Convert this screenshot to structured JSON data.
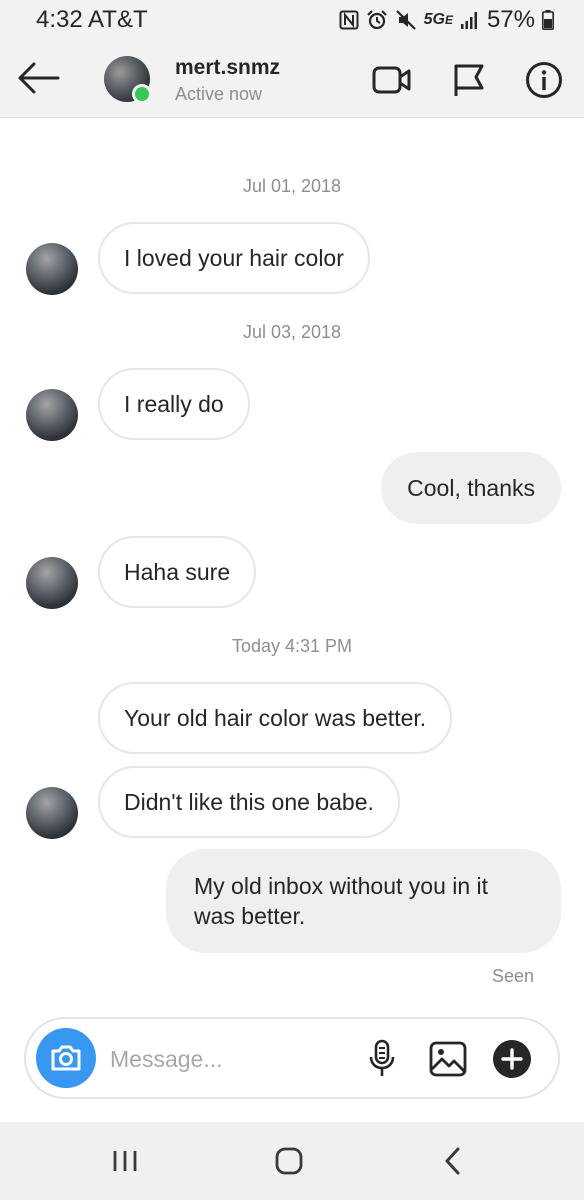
{
  "status_bar": {
    "time": "4:32 AT&T",
    "network": "5G",
    "network_suffix": "E",
    "battery": "57%"
  },
  "header": {
    "contact_name": "mert.snmz",
    "contact_status": "Active now",
    "online_color": "#34c759"
  },
  "conversation": {
    "dates": [
      "Jul 01, 2018",
      "Jul 03, 2018",
      "Today 4:31 PM"
    ],
    "messages": [
      {
        "from": "them",
        "text": "I loved your hair color"
      },
      {
        "from": "them",
        "text": "I really do"
      },
      {
        "from": "me",
        "text": "Cool, thanks"
      },
      {
        "from": "them",
        "text": "Haha sure"
      },
      {
        "from": "them",
        "text": "Your old hair color was better."
      },
      {
        "from": "them",
        "text": "Didn't like this one babe."
      },
      {
        "from": "me",
        "text": "My old inbox without you in it was better."
      }
    ],
    "seen": "Seen"
  },
  "composer": {
    "placeholder": "Message...",
    "accent": "#3897f0"
  },
  "icons": {
    "header": [
      "back-arrow-icon",
      "video-camera-icon",
      "flag-icon",
      "info-icon"
    ],
    "composer": [
      "camera-icon",
      "microphone-icon",
      "gallery-icon",
      "plus-icon"
    ],
    "nav": [
      "recent-apps-icon",
      "home-icon",
      "back-icon"
    ]
  }
}
